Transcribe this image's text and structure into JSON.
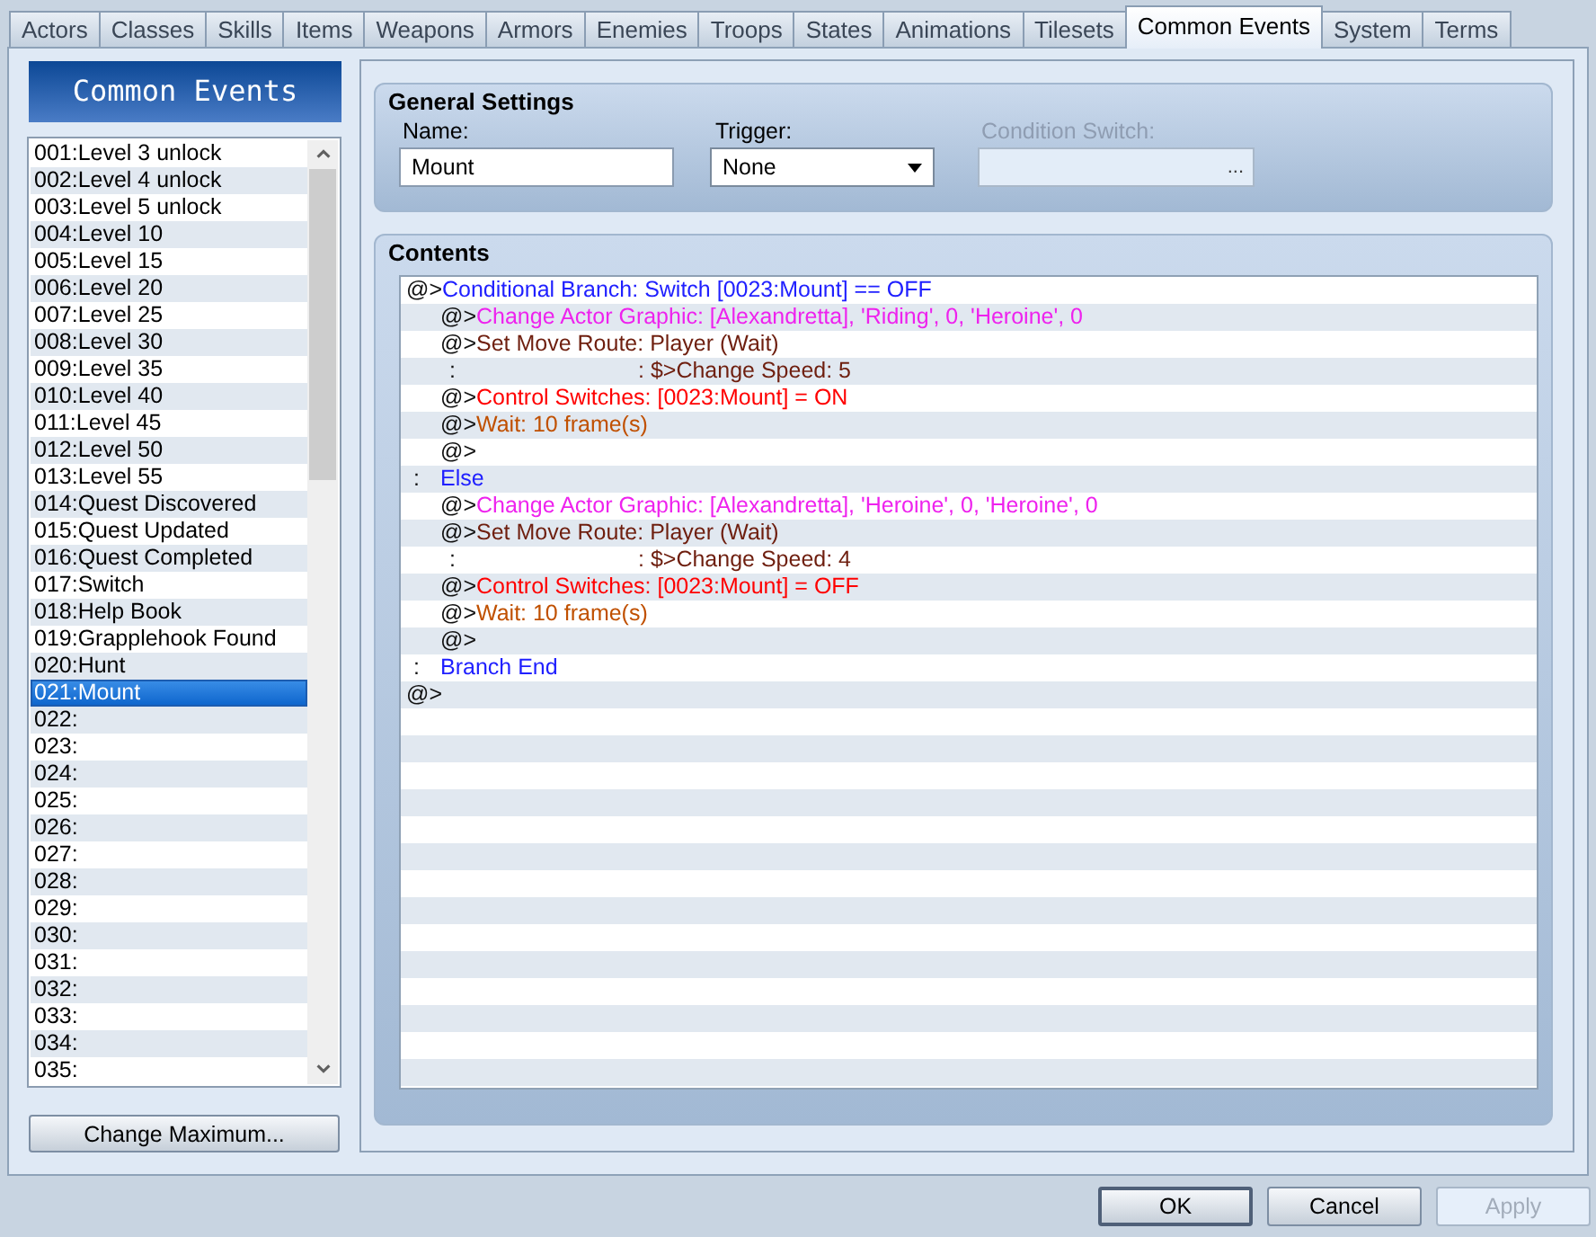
{
  "tabs": [
    {
      "label": "Actors",
      "selected": false
    },
    {
      "label": "Classes",
      "selected": false
    },
    {
      "label": "Skills",
      "selected": false
    },
    {
      "label": "Items",
      "selected": false
    },
    {
      "label": "Weapons",
      "selected": false
    },
    {
      "label": "Armors",
      "selected": false
    },
    {
      "label": "Enemies",
      "selected": false
    },
    {
      "label": "Troops",
      "selected": false
    },
    {
      "label": "States",
      "selected": false
    },
    {
      "label": "Animations",
      "selected": false
    },
    {
      "label": "Tilesets",
      "selected": false
    },
    {
      "label": "Common Events",
      "selected": true
    },
    {
      "label": "System",
      "selected": false
    },
    {
      "label": "Terms",
      "selected": false
    }
  ],
  "sidebar": {
    "title": "Common Events",
    "items": [
      {
        "label": "001:Level 3 unlock",
        "selected": false
      },
      {
        "label": "002:Level 4 unlock",
        "selected": false
      },
      {
        "label": "003:Level 5 unlock",
        "selected": false
      },
      {
        "label": "004:Level 10",
        "selected": false
      },
      {
        "label": "005:Level 15",
        "selected": false
      },
      {
        "label": "006:Level 20",
        "selected": false
      },
      {
        "label": "007:Level 25",
        "selected": false
      },
      {
        "label": "008:Level 30",
        "selected": false
      },
      {
        "label": "009:Level 35",
        "selected": false
      },
      {
        "label": "010:Level 40",
        "selected": false
      },
      {
        "label": "011:Level 45",
        "selected": false
      },
      {
        "label": "012:Level 50",
        "selected": false
      },
      {
        "label": "013:Level 55",
        "selected": false
      },
      {
        "label": "014:Quest Discovered",
        "selected": false
      },
      {
        "label": "015:Quest Updated",
        "selected": false
      },
      {
        "label": "016:Quest Completed",
        "selected": false
      },
      {
        "label": "017:Switch",
        "selected": false
      },
      {
        "label": "018:Help Book",
        "selected": false
      },
      {
        "label": "019:Grapplehook Found",
        "selected": false
      },
      {
        "label": "020:Hunt",
        "selected": false
      },
      {
        "label": "021:Mount",
        "selected": true
      },
      {
        "label": "022:",
        "selected": false
      },
      {
        "label": "023:",
        "selected": false
      },
      {
        "label": "024:",
        "selected": false
      },
      {
        "label": "025:",
        "selected": false
      },
      {
        "label": "026:",
        "selected": false
      },
      {
        "label": "027:",
        "selected": false
      },
      {
        "label": "028:",
        "selected": false
      },
      {
        "label": "029:",
        "selected": false
      },
      {
        "label": "030:",
        "selected": false
      },
      {
        "label": "031:",
        "selected": false
      },
      {
        "label": "032:",
        "selected": false
      },
      {
        "label": "033:",
        "selected": false
      },
      {
        "label": "034:",
        "selected": false
      },
      {
        "label": "035:",
        "selected": false
      }
    ],
    "button": "Change Maximum..."
  },
  "general_settings": {
    "title": "General Settings",
    "name": {
      "label": "Name:",
      "value": "Mount"
    },
    "trigger": {
      "label": "Trigger:",
      "value": "None"
    },
    "condition_switch": {
      "label": "Condition Switch:",
      "disabled": true,
      "button": "..."
    }
  },
  "contents": {
    "title": "Contents",
    "commands": [
      {
        "kind": "command",
        "prefix": "@>",
        "text": "Conditional Branch: Switch [0023:Mount] == OFF",
        "color": "#2020ff",
        "children": [
          {
            "kind": "command",
            "prefix": "@>",
            "text": "Change Actor Graphic: [Alexandretta], 'Riding', 0, 'Heroine', 0",
            "color": "#ee22ee"
          },
          {
            "kind": "command",
            "prefix": "@>",
            "text": "Set Move Route: Player (Wait)",
            "color": "#6e1e0e"
          },
          {
            "kind": "step",
            "prefix": ":",
            "text": ": $>Change Speed: 5",
            "color": "#6e1e0e"
          },
          {
            "kind": "command",
            "prefix": "@>",
            "text": "Control Switches: [0023:Mount] = ON",
            "color": "#ff0000"
          },
          {
            "kind": "command",
            "prefix": "@>",
            "text": "Wait: 10 frame(s)",
            "color": "#c05000"
          },
          {
            "kind": "command",
            "prefix": "@>"
          }
        ]
      },
      {
        "kind": "branch",
        "prefix": ":",
        "text": "Else",
        "color": "#2020ff",
        "children": [
          {
            "kind": "command",
            "prefix": "@>",
            "text": "Change Actor Graphic: [Alexandretta], 'Heroine', 0, 'Heroine', 0",
            "color": "#ee22ee"
          },
          {
            "kind": "command",
            "prefix": "@>",
            "text": "Set Move Route: Player (Wait)",
            "color": "#6e1e0e"
          },
          {
            "kind": "step",
            "prefix": ":",
            "text": ": $>Change Speed: 4",
            "color": "#6e1e0e"
          },
          {
            "kind": "command",
            "prefix": "@>",
            "text": "Control Switches: [0023:Mount] = OFF",
            "color": "#ff0000"
          },
          {
            "kind": "command",
            "prefix": "@>",
            "text": "Wait: 10 frame(s)",
            "color": "#c05000"
          },
          {
            "kind": "command",
            "prefix": "@>"
          }
        ]
      },
      {
        "kind": "branch",
        "prefix": ":",
        "text": "Branch End",
        "color": "#2020ff"
      },
      {
        "kind": "command",
        "prefix": "@>"
      }
    ]
  },
  "buttons": [
    {
      "label": "OK",
      "default": true,
      "disabled": false
    },
    {
      "label": "Cancel",
      "default": false,
      "disabled": false
    },
    {
      "label": "Apply",
      "default": false,
      "disabled": true
    }
  ]
}
